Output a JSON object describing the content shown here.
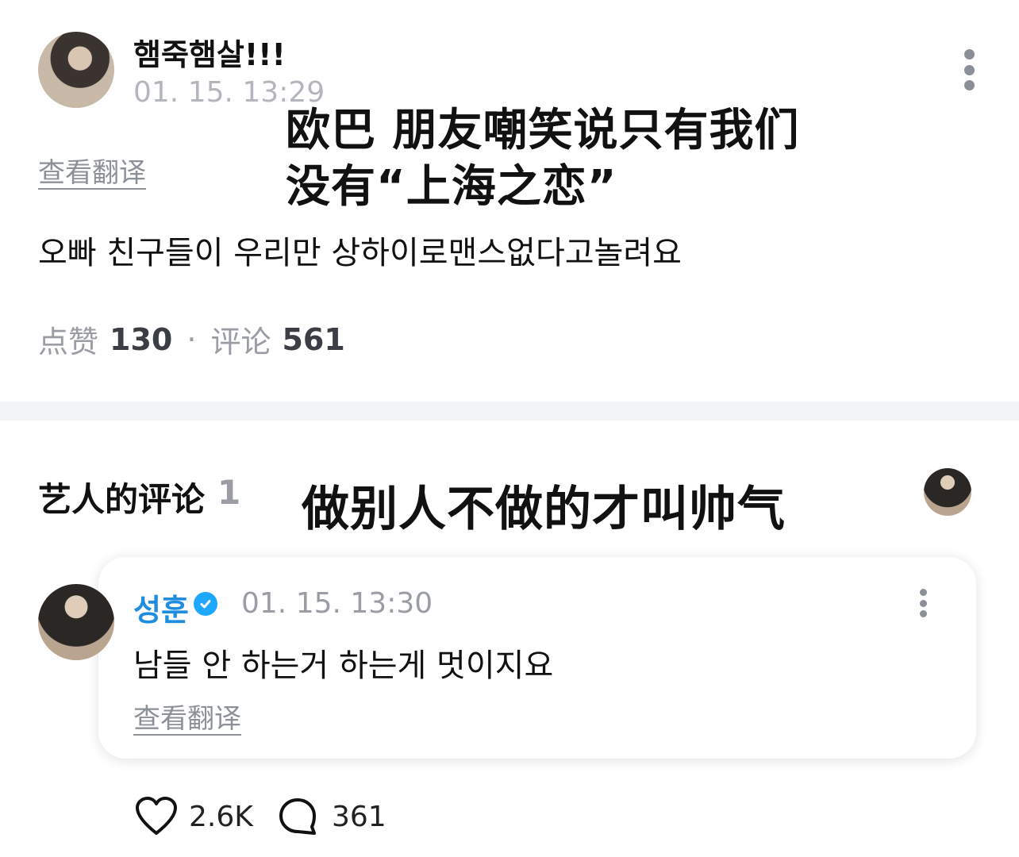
{
  "post": {
    "author_name": "햄죽햄살!!!",
    "timestamp": "01. 15. 13:29",
    "translate_label": "查看翻译",
    "body_text": "오빠 친구들이 우리만 상하이로맨스없다고놀려요",
    "likes_label": "点赞",
    "likes_count": "130",
    "separator": "·",
    "comments_label": "评论",
    "comments_count": "561"
  },
  "overlay": {
    "caption_line1": "欧巴 朋友嘲笑说只有我们",
    "caption_line2": "没有“上海之恋”",
    "caption_artist": "做别人不做的才叫帅气"
  },
  "artist_section": {
    "title": "艺人的评论",
    "count": "1"
  },
  "artist_comment": {
    "author_name": "성훈",
    "timestamp": "01. 15. 13:30",
    "body_text": "남들 안 하는거 하는게 멋이지요",
    "translate_label": "查看翻译",
    "likes_count": "2.6K",
    "replies_count": "361"
  },
  "colors": {
    "accent_blue": "#1e8de0",
    "badge_blue": "#1ea7ff",
    "muted_gray": "#8c9098",
    "divider": "#f2f3f5"
  },
  "icons": [
    "kebab-icon",
    "verified-badge-icon",
    "heart-icon",
    "comment-bubble-icon"
  ]
}
